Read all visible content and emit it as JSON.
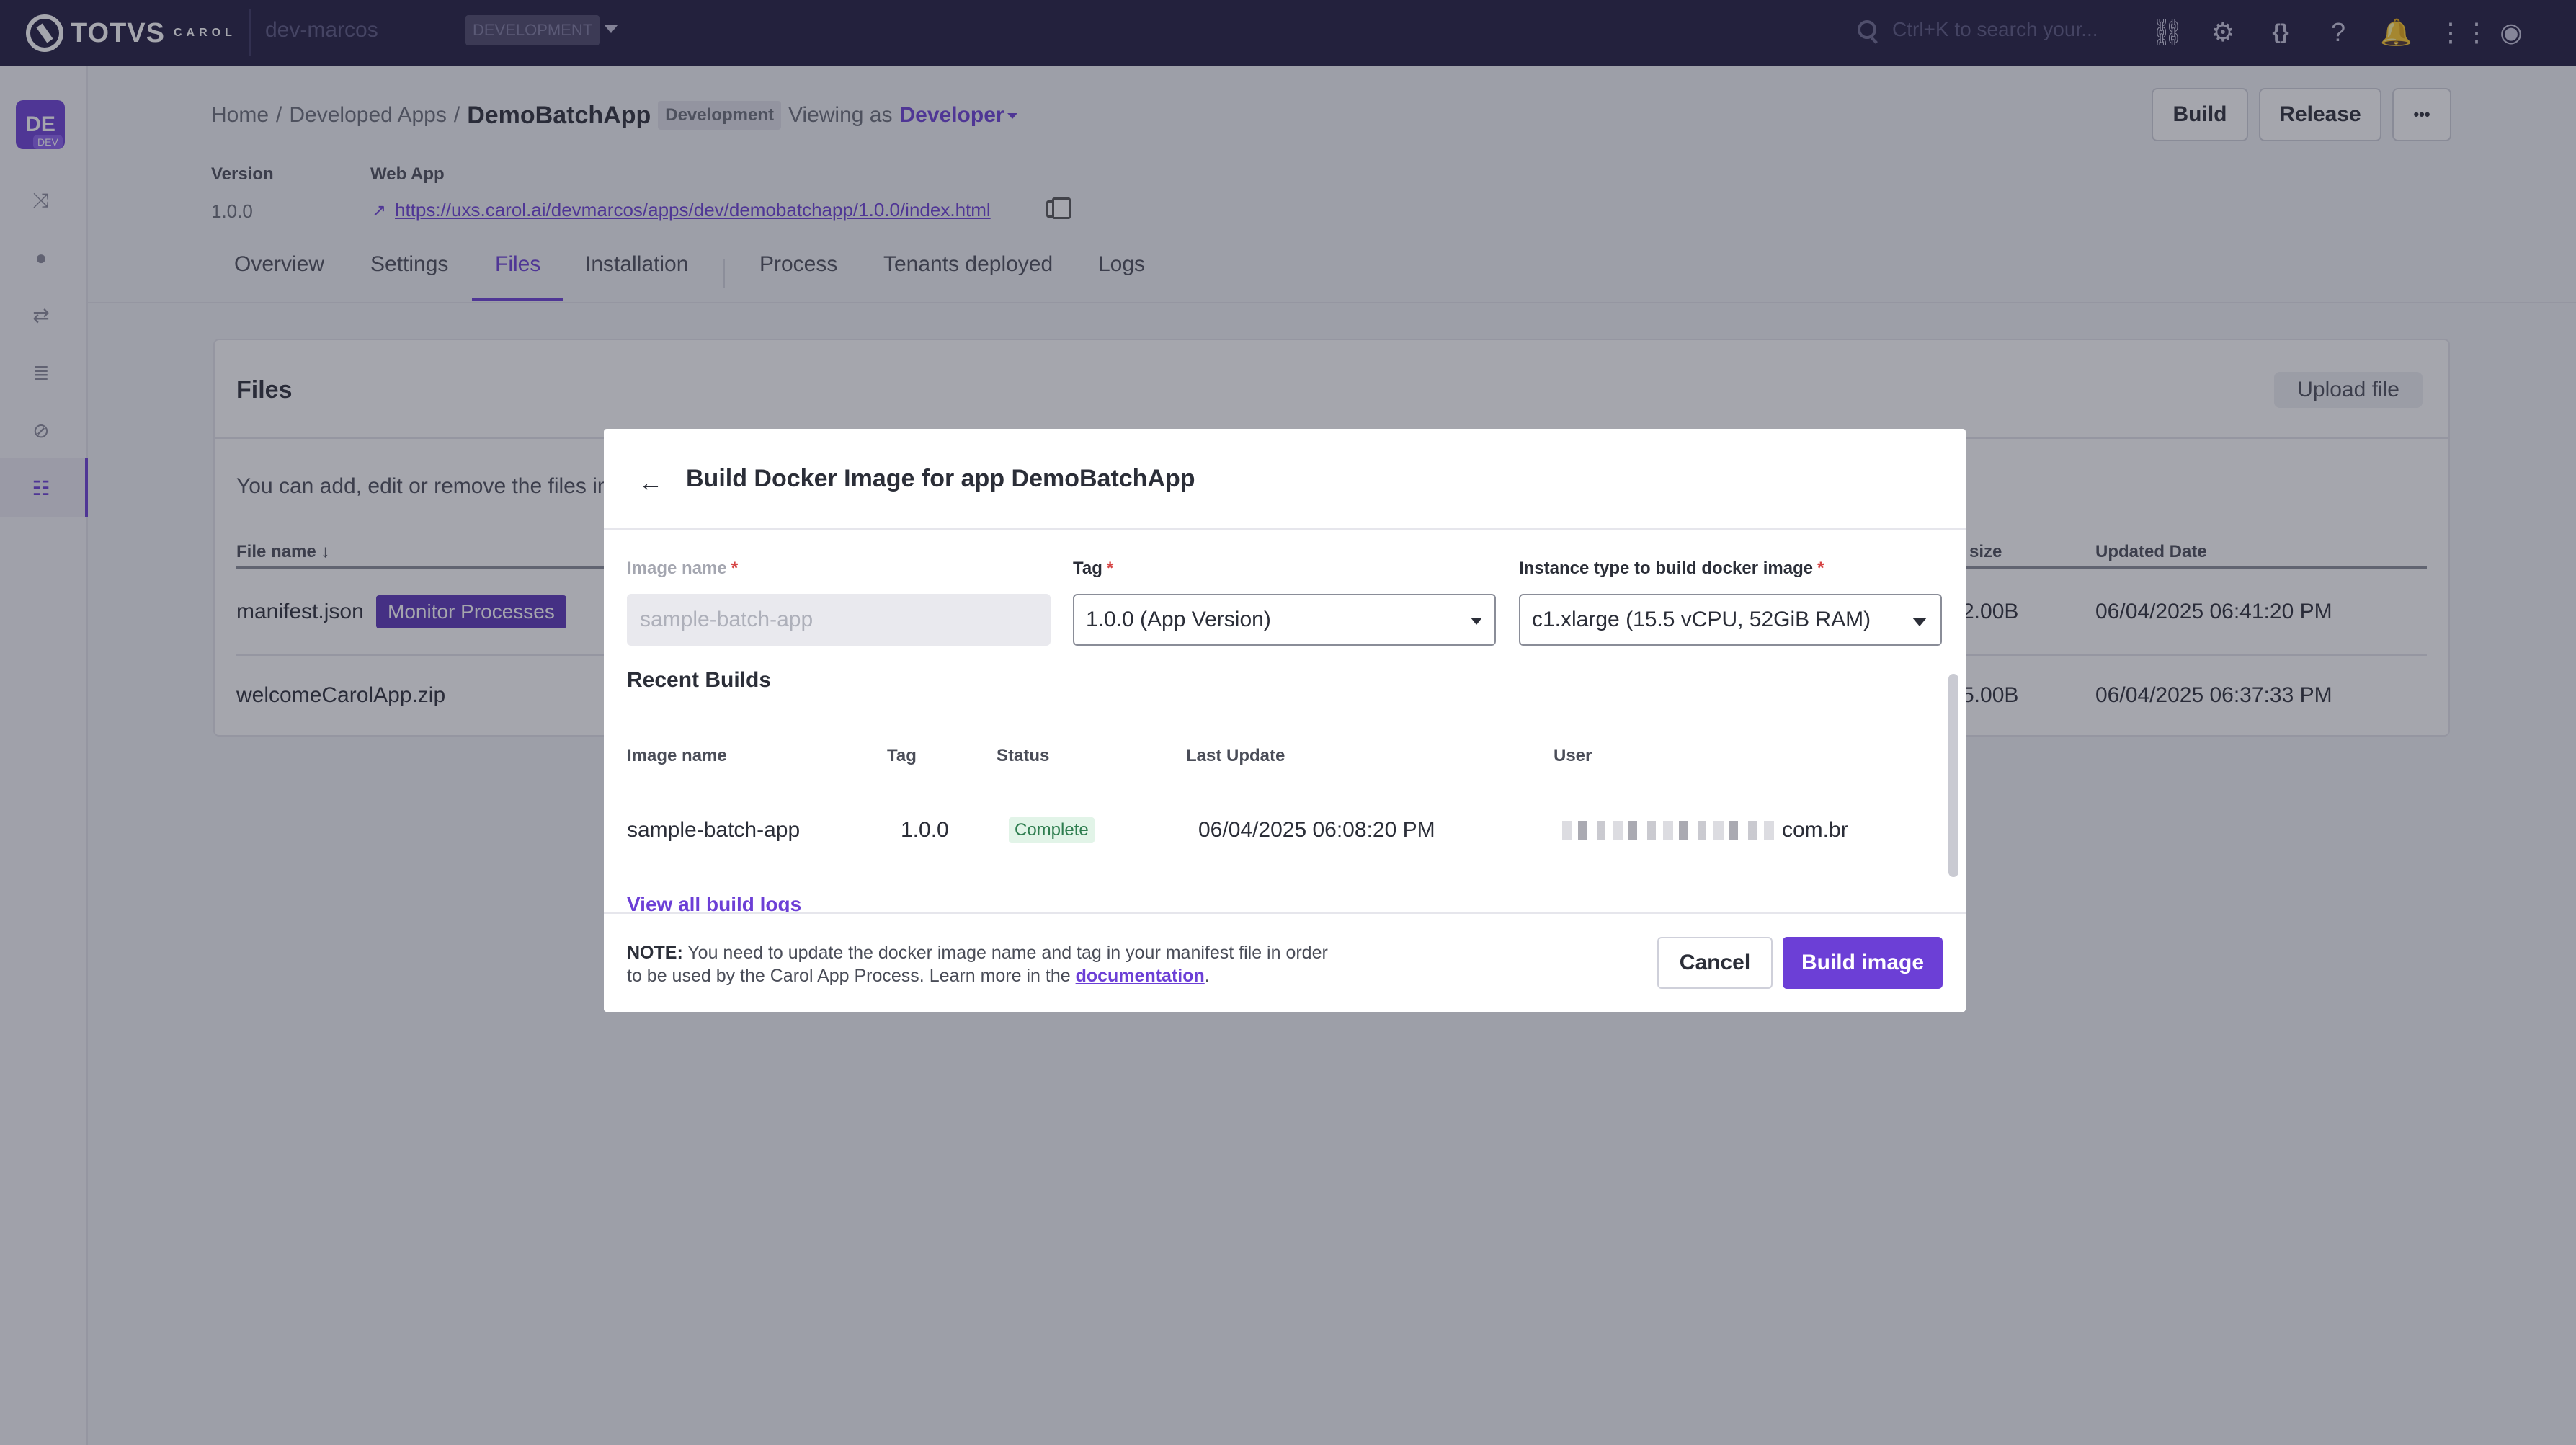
{
  "topbar": {
    "brand": "TOTVS",
    "brand_sub": "CAROL",
    "org": "dev-marcos",
    "environment": "DEVELOPMENT",
    "search_placeholder": "Ctrl+K to search your...",
    "icons": [
      "link-icon",
      "gear-icon",
      "code-braces-icon",
      "help-icon",
      "bell-icon",
      "apps-grid-icon",
      "user-profile-icon"
    ]
  },
  "sidebar": {
    "avatar_initials": "DE",
    "avatar_badge": "DEV",
    "items": [
      "shuffle-icon",
      "location-pin-icon",
      "routes-icon",
      "database-icon",
      "compass-icon",
      "apps-icon"
    ],
    "active_index": 5
  },
  "breadcrumb": {
    "home": "Home",
    "sep": "/",
    "parent": "Developed Apps",
    "current": "DemoBatchApp",
    "env_badge": "Development",
    "viewing_as": "Viewing as",
    "role": "Developer"
  },
  "header_buttons": {
    "build": "Build",
    "release": "Release",
    "more": "•••"
  },
  "meta": {
    "version_label": "Version",
    "version_value": "1.0.0",
    "webapp_label": "Web App",
    "webapp_url": "https://uxs.carol.ai/devmarcos/apps/dev/demobatchapp/1.0.0/index.html"
  },
  "tabs": [
    {
      "label": "Overview"
    },
    {
      "label": "Settings"
    },
    {
      "label": "Files",
      "active": true
    },
    {
      "label": "Installation"
    },
    {
      "label": "Process"
    },
    {
      "label": "Tenants deployed"
    },
    {
      "label": "Logs"
    }
  ],
  "files_card": {
    "title": "Files",
    "upload_label": "Upload file",
    "description": "You can add, edit or remove the files in",
    "columns": {
      "name": "File name",
      "size": "size",
      "updated": "Updated Date"
    },
    "rows": [
      {
        "name": "manifest.json",
        "badge": "Monitor Processes",
        "size": "2.00B",
        "updated": "06/04/2025 06:41:20 PM"
      },
      {
        "name": "welcomeCarolApp.zip",
        "size": "5.00B",
        "updated": "06/04/2025 06:37:33 PM"
      }
    ]
  },
  "modal": {
    "title": "Build Docker Image for app DemoBatchApp",
    "fields": {
      "image_name_label": "Image name",
      "image_name_value": "sample-batch-app",
      "tag_label": "Tag",
      "tag_value": "1.0.0 (App Version)",
      "instance_label": "Instance type to build docker image",
      "instance_value": "c1.xlarge (15.5 vCPU, 52GiB RAM)",
      "required_mark": "*"
    },
    "recent_builds": {
      "title": "Recent Builds",
      "columns": {
        "image_name": "Image name",
        "tag": "Tag",
        "status": "Status",
        "last_update": "Last Update",
        "user": "User"
      },
      "rows": [
        {
          "image_name": "sample-batch-app",
          "tag": "1.0.0",
          "status": "Complete",
          "last_update": "06/04/2025 06:08:20 PM",
          "user_suffix": "com.br"
        }
      ],
      "view_all": "View all build logs"
    },
    "footer": {
      "note_label": "NOTE:",
      "note_text": "You need to update the docker image name and tag in your manifest file in order to be used by the Carol App Process. Learn more in the",
      "note_link": "documentation",
      "note_end": ".",
      "cancel": "Cancel",
      "build": "Build image"
    }
  },
  "colors": {
    "topbar": "#1f1b3f",
    "accent": "#6c3fd6",
    "badge_complete_bg": "#e2f4e8",
    "badge_complete_fg": "#2e7d4f"
  }
}
